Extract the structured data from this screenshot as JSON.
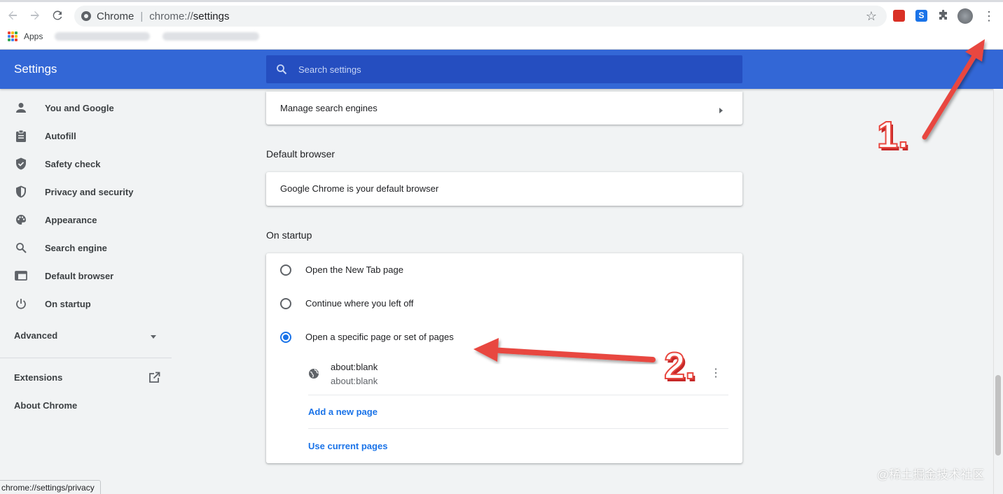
{
  "browser": {
    "site_name": "Chrome",
    "url_prefix": "chrome://",
    "url_host": "settings",
    "bookmarks_apps_label": "Apps",
    "extension_s_label": "S"
  },
  "settings": {
    "title": "Settings",
    "search_placeholder": "Search settings"
  },
  "sidebar": {
    "items": [
      {
        "label": "You and Google",
        "icon": "person-icon"
      },
      {
        "label": "Autofill",
        "icon": "clipboard-icon"
      },
      {
        "label": "Safety check",
        "icon": "shield-check-icon"
      },
      {
        "label": "Privacy and security",
        "icon": "shield-icon"
      },
      {
        "label": "Appearance",
        "icon": "palette-icon"
      },
      {
        "label": "Search engine",
        "icon": "search-icon"
      },
      {
        "label": "Default browser",
        "icon": "browser-window-icon"
      },
      {
        "label": "On startup",
        "icon": "power-icon"
      }
    ],
    "advanced_label": "Advanced",
    "extensions_label": "Extensions",
    "about_label": "About Chrome"
  },
  "main": {
    "manage_search_engines": "Manage search engines",
    "default_browser_title": "Default browser",
    "default_browser_status": "Google Chrome is your default browser",
    "on_startup_title": "On startup",
    "startup_options": [
      {
        "label": "Open the New Tab page",
        "checked": false
      },
      {
        "label": "Continue where you left off",
        "checked": false
      },
      {
        "label": "Open a specific page or set of pages",
        "checked": true
      }
    ],
    "startup_page": {
      "title": "about:blank",
      "url": "about:blank"
    },
    "add_new_page": "Add a new page",
    "use_current_pages": "Use current pages"
  },
  "status_bar": {
    "url": "chrome://settings/privacy"
  },
  "annotations": {
    "step1": "1.",
    "step2": "2.",
    "color": "#e8473f"
  },
  "watermark": "@稀土掘金技术社区",
  "colors": {
    "header": "#3367d6",
    "search_box": "#254ec0",
    "accent": "#1a73e8"
  }
}
